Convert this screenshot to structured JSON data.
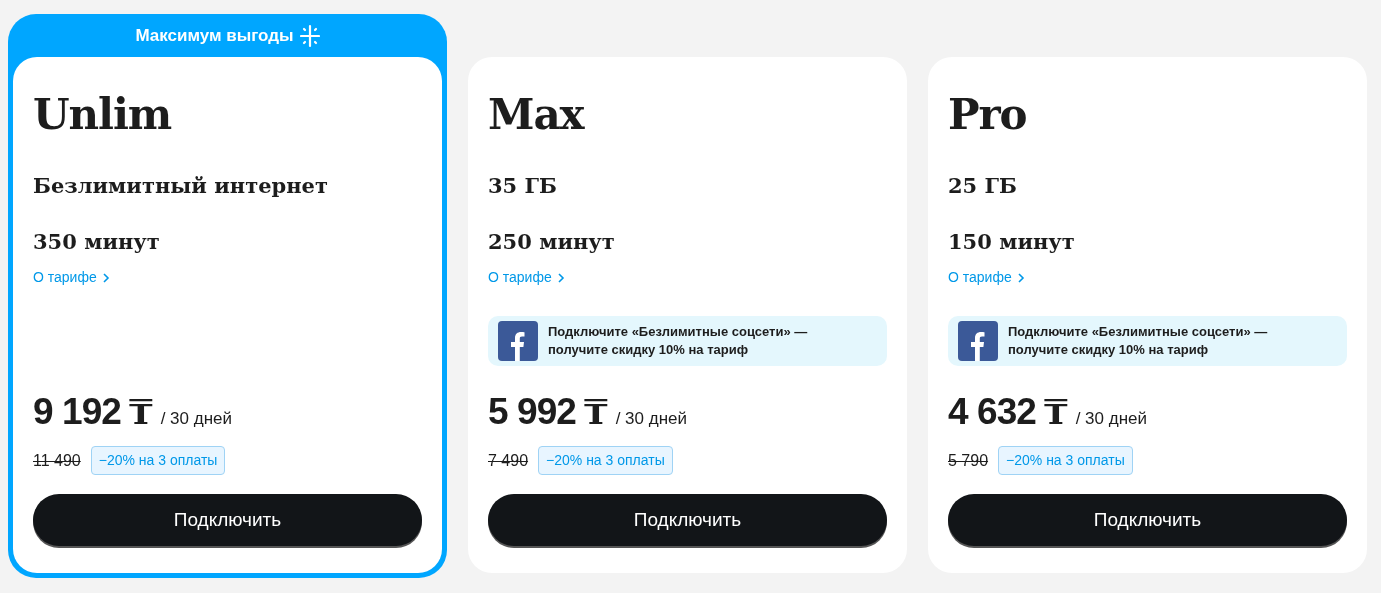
{
  "plans": [
    {
      "badge": "Максимум выгоды",
      "featured": true,
      "name": "Unlim",
      "features": [
        "Безлимитный интернет",
        "350 минут"
      ],
      "link": "О тарифе",
      "price": "9 192",
      "currency": "₸",
      "period": "/ 30 дней",
      "old_price": "11 490",
      "discount": "−20% на 3 оплаты",
      "button": "Подключить"
    },
    {
      "featured": false,
      "name": "Max",
      "features": [
        "35 ГБ",
        "250 минут"
      ],
      "link": "О тарифе",
      "promo": "Подключите «Безлимитные соцсети» — получите скидку 10% на тариф",
      "price": "5 992",
      "currency": "₸",
      "period": "/ 30 дней",
      "old_price": "7 490",
      "discount": "−20% на 3 оплаты",
      "button": "Подключить"
    },
    {
      "featured": false,
      "name": "Pro",
      "features": [
        "25 ГБ",
        "150 минут"
      ],
      "link": "О тарифе",
      "promo": "Подключите «Безлимитные соцсети» — получите скидку 10% на тариф",
      "price": "4 632",
      "currency": "₸",
      "period": "/ 30 дней",
      "old_price": "5 790",
      "discount": "−20% на 3 оплаты",
      "button": "Подключить"
    }
  ]
}
